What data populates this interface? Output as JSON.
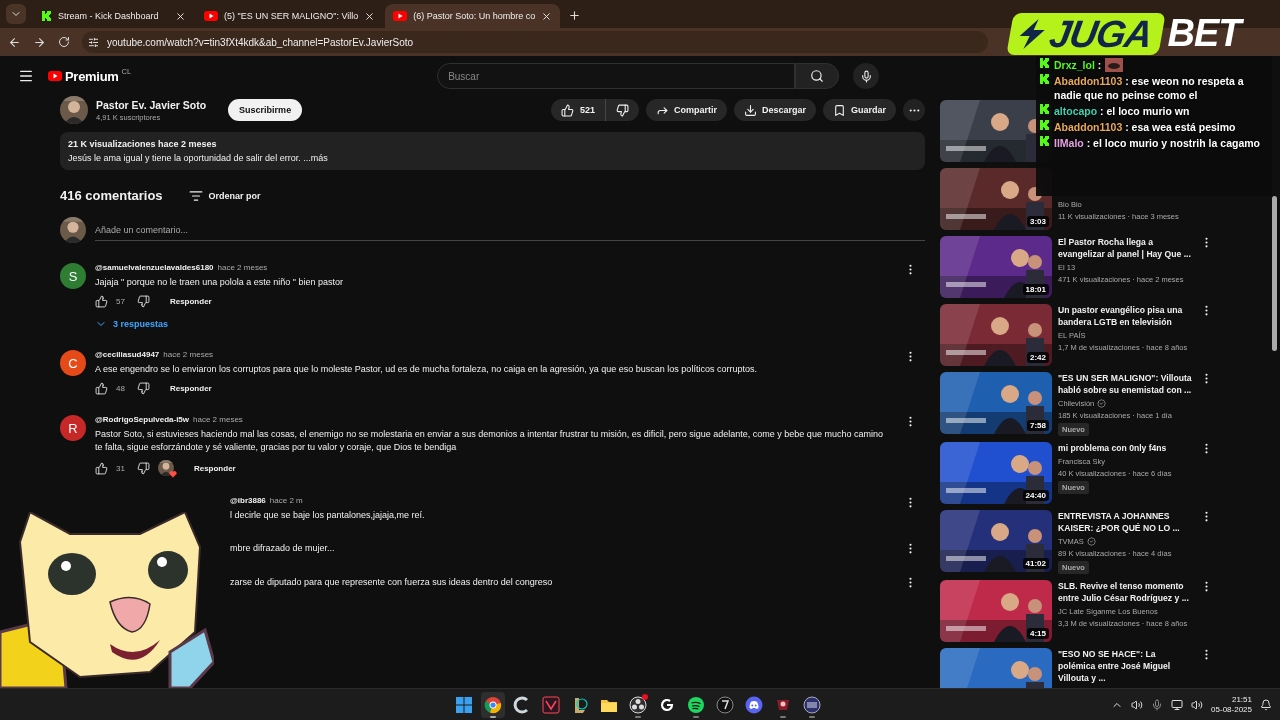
{
  "browser": {
    "tabs": [
      {
        "kind": "kick",
        "label": "Stream - Kick Dashboard",
        "selected": false
      },
      {
        "kind": "youtube",
        "label": "(5) \"ES UN SER MALIGNO\": Villo",
        "selected": false
      },
      {
        "kind": "youtube",
        "label": "(6) Pastor Soto: Un hombre co",
        "selected": true
      }
    ],
    "address": "youtube.com/watch?v=tin3fXt4kdk&ab_channel=PastorEv.JavierSoto"
  },
  "header": {
    "logo": "Premium",
    "region": "CL",
    "search": {
      "placeholder": "Buscar"
    }
  },
  "channel": {
    "name": "Pastor Ev. Javier Soto",
    "subscribers": "4,91 K suscriptores",
    "subscribe": "Suscribirme"
  },
  "actions": {
    "likes": "521",
    "share": "Compartir",
    "download": "Descargar",
    "save": "Guardar"
  },
  "description": {
    "stats": "21 K visualizaciones  hace 2 meses",
    "text": "Jesús le ama igual y tiene la oportunidad de salir del error. ...más"
  },
  "comments_header": {
    "count": "416 comentarios",
    "sort": "Ordenar por",
    "placeholder": "Añade un comentario..."
  },
  "comments": [
    {
      "kind": "full",
      "avatar_letter": "S",
      "color": "#2e7d32",
      "author": "@samuelvalenzuelavaldes6180",
      "time": "hace 2 meses",
      "text": "Jajaja \" porque no le traen una polola a este niño \" bien pastor",
      "likes": "57",
      "creator_heart": false,
      "reply": "Responder",
      "replies": "3 respuestas"
    },
    {
      "kind": "full",
      "avatar_letter": "C",
      "color": "#e64a19",
      "author": "@ceciliasud4947",
      "time": "hace 2 meses",
      "text": "A ese engendro se lo enviaron los corruptos para que lo moleste Pastor, ud es de mucha fortaleza, no caiga en la agresión, ya que eso buscan los políticos corruptos.",
      "likes": "48",
      "creator_heart": false,
      "reply": "Responder"
    },
    {
      "kind": "full",
      "avatar_letter": "R",
      "color": "#c62828",
      "author": "@RodrigoSepulveda-i5w",
      "time": "hace 2 meses",
      "text": "Pastor Soto, si estuvieses haciendo mal las cosas, el enemigo no se molestaria en enviar a sus demonios a intentar frustrar tu misión, es dificil, pero sigue adelante, come y bebe que mucho camino te falta, sigue esforzándote y sé valiente, gracias por tu valor y coraje, que Dios te bendiga",
      "likes": "31",
      "creator_heart": true,
      "reply": "Responder"
    },
    {
      "kind": "partial",
      "author": "@ibr3886",
      "time": "hace 2 m",
      "text": "l decirle que se baje los pantalones,jajaja,me reí."
    },
    {
      "kind": "partial",
      "text": "mbre difrazado de mujer..."
    },
    {
      "kind": "partial",
      "text": "zarse de diputado para que represente con fuerza sus ideas dentro del congreso"
    }
  ],
  "videos": [
    {
      "kind": "hidden"
    },
    {
      "kind": "hidden",
      "duration": "3:03",
      "channel": "Bio Bio",
      "meta": "11 K visualizaciones · hace 3 meses"
    },
    {
      "kind": "full",
      "title": "El Pastor Rocha llega a evangelizar al panel | Hay Que ...",
      "channel": "El 13",
      "meta": "471 K visualizaciones · hace 2 meses",
      "duration": "18:01"
    },
    {
      "kind": "full",
      "title": "Un pastor evangélico pisa una bandera LGTB en televisión",
      "channel": "EL PAÍS",
      "meta": "1,7 M de visualizaciones · hace 8 años",
      "duration": "2:42"
    },
    {
      "kind": "full",
      "title": "\"ES UN SER MALIGNO\": Villouta habló sobre su enemistad con ...",
      "channel": "Chilevisión",
      "verified": true,
      "meta": "185 K visualizaciones · hace 1 día",
      "badge": "Nuevo",
      "duration": "7:58"
    },
    {
      "kind": "full",
      "title": "mi problema con 0nly f4ns",
      "channel": "Francisca Sky",
      "meta": "40 K visualizaciones · hace 6 días",
      "badge": "Nuevo",
      "duration": "24:40"
    },
    {
      "kind": "full",
      "title": "ENTREVISTA A JOHANNES KAISER: ¿POR QUÉ NO LO ...",
      "channel": "TVMAS",
      "verified": true,
      "meta": "89 K visualizaciones · hace 4 días",
      "badge": "Nuevo",
      "duration": "41:02"
    },
    {
      "kind": "full",
      "title": "SLB. Revive el tenso momento entre Julio César Rodríguez y ...",
      "channel": "JC Late Síganme Los Buenos",
      "meta": "3,3 M de visualizaciones · hace 8 años",
      "duration": "4:15"
    },
    {
      "kind": "full",
      "title": "\"ESO NO SE HACE\": La polémica entre José Miguel Villouta y ..."
    }
  ],
  "overlay": {
    "logo": [
      "JUGA",
      "BET"
    ],
    "chat": [
      {
        "user": "Drxz_lol",
        "color": "#53fc18",
        "text": ":",
        "emote": true
      },
      {
        "user": "Abaddon1103",
        "color": "#e8a95a",
        "text": ": ese weon no respeta a nadie que no peinse como el",
        "emote": false
      },
      {
        "user": "altocapo",
        "color": "#3fd1b0",
        "text": ": el loco murio wn",
        "emote": false
      },
      {
        "user": "Abaddon1103",
        "color": "#e8a95a",
        "text": ": esa wea está pesimo",
        "emote": false
      },
      {
        "user": "IlMalo",
        "color": "#e6a2e0",
        "text": ": el loco murio y nostrih la cagamo",
        "emote": false
      }
    ]
  },
  "taskbar": {
    "apps": [
      {
        "kind": "windows",
        "selected": false,
        "running": false
      },
      {
        "kind": "chrome",
        "selected": true,
        "running": true
      },
      {
        "kind": "ccleaner",
        "selected": false,
        "running": false
      },
      {
        "kind": "valorant",
        "selected": false,
        "running": false
      },
      {
        "kind": "league",
        "selected": false,
        "running": false
      },
      {
        "kind": "folder",
        "selected": false,
        "running": false
      },
      {
        "kind": "obs",
        "selected": false,
        "running": true,
        "alert": true
      },
      {
        "kind": "logitech",
        "selected": false,
        "running": false
      },
      {
        "kind": "spotify",
        "selected": false,
        "running": true
      },
      {
        "kind": "epic",
        "selected": false,
        "running": false
      },
      {
        "kind": "discord",
        "selected": false,
        "running": false
      },
      {
        "kind": "mapp",
        "selected": false,
        "running": true
      },
      {
        "kind": "grid",
        "selected": false,
        "running": true
      }
    ],
    "time": "21:51",
    "date": "05-08-2025"
  }
}
